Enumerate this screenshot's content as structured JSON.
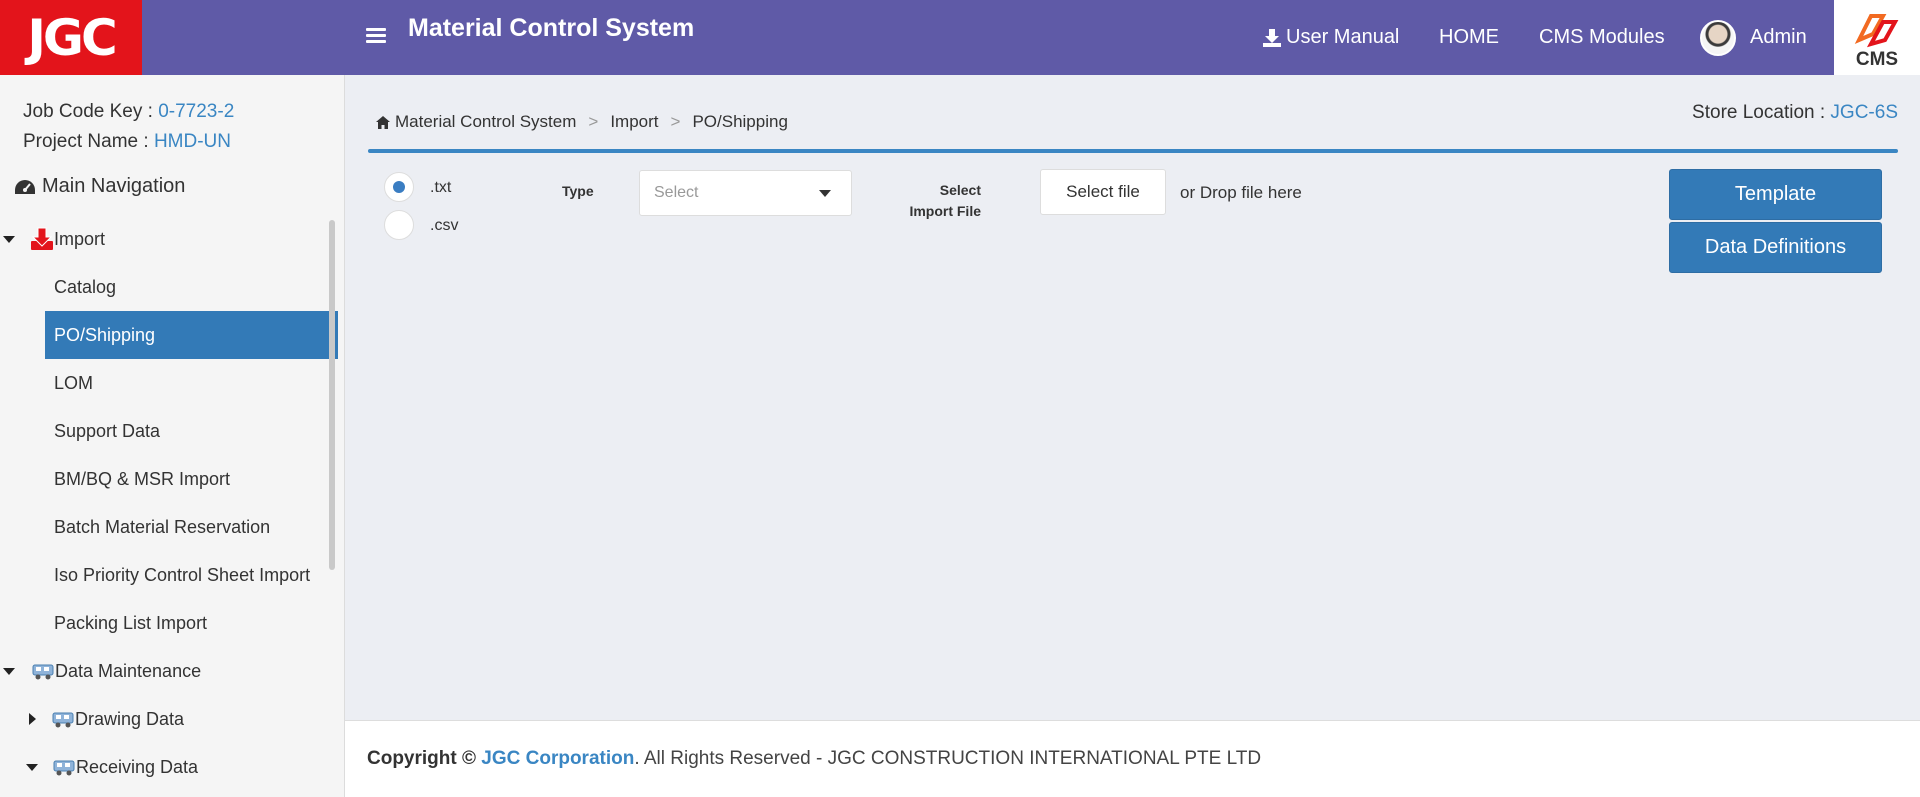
{
  "header": {
    "logo_text": "JGC",
    "app_title": "Material Control System",
    "user_manual": "User Manual",
    "home": "HOME",
    "cms_modules": "CMS Modules",
    "user_name": "Admin",
    "cms_logo_text": "CMS",
    "bg_color": "#5f5aa7"
  },
  "sidebar": {
    "job_code_label": "Job Code Key : ",
    "job_code_value": "0-7723-2",
    "project_label": "Project Name : ",
    "project_value": "HMD-UN",
    "main_nav": "Main Navigation",
    "import_group": "Import",
    "import_items": [
      "Catalog",
      "PO/Shipping",
      "LOM",
      "Support Data",
      "BM/BQ & MSR Import",
      "Batch Material Reservation",
      "Iso Priority Control Sheet Import",
      "Packing List Import"
    ],
    "active_item": "PO/Shipping",
    "data_maintenance": "Data Maintenance",
    "drawing_data": "Drawing Data",
    "receiving_data": "Receiving Data"
  },
  "main": {
    "breadcrumb": [
      "Material Control System",
      "Import",
      "PO/Shipping"
    ],
    "breadcrumb_sep": ">",
    "store_label": "Store Location : ",
    "store_value": "JGC-6S",
    "radio_txt": ".txt",
    "radio_csv": ".csv",
    "type_label": "Type",
    "type_placeholder": "Select",
    "select_import_line1": "Select",
    "select_import_line2": "Import File",
    "select_file_btn": "Select file",
    "drop_text": "or Drop file here",
    "template_btn": "Template",
    "data_definitions_btn": "Data Definitions"
  },
  "footer": {
    "copyright": "Copyright © ",
    "corp": "JGC Corporation",
    "rest": ". All Rights Reserved - JGC CONSTRUCTION INTERNATIONAL PTE LTD"
  }
}
